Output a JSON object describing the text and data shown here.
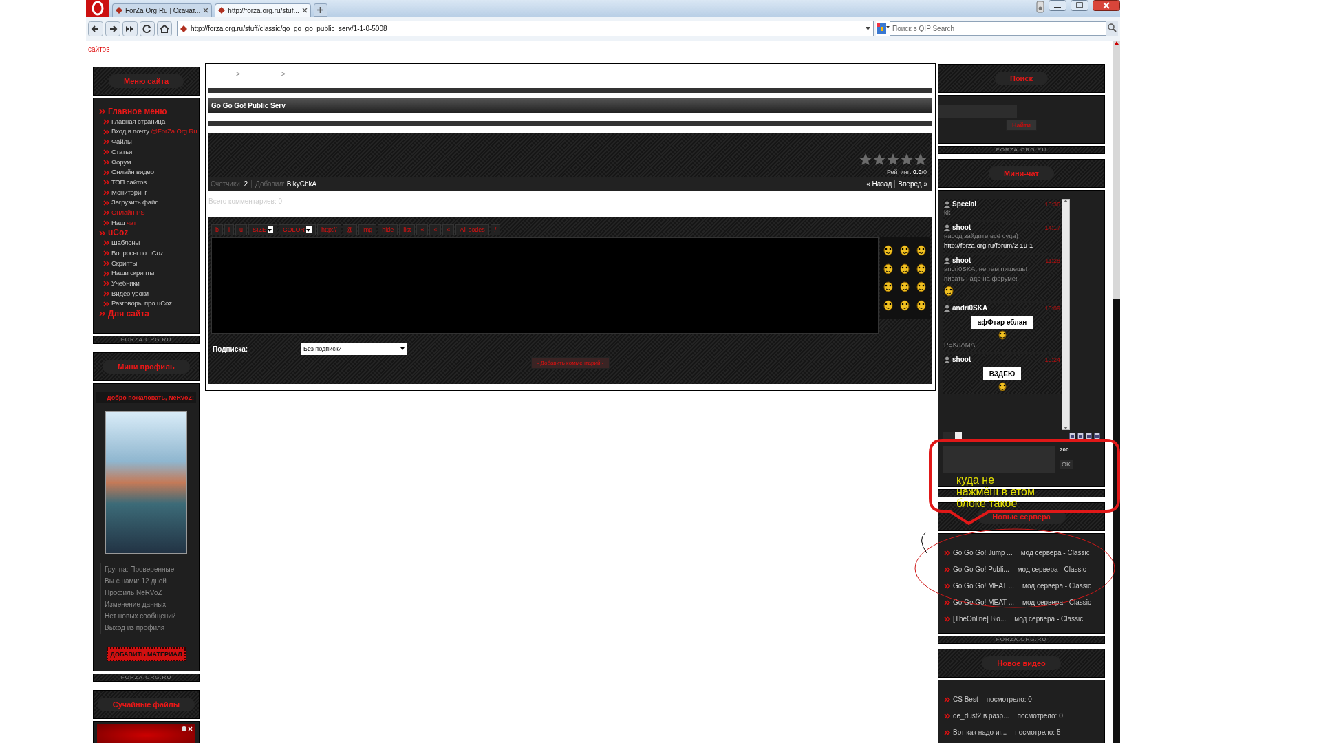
{
  "browser": {
    "tabs": [
      {
        "title": "ForZa Org Ru | Скачат...",
        "selected": false
      },
      {
        "title": "http://forza.org.ru/stuf...",
        "selected": true
      }
    ],
    "address": "http://forza.org.ru/stuff/classic/go_go_go_public_serv/1-1-0-5008",
    "search_placeholder": "Поиск в QIP Search",
    "status_text": "сайтов"
  },
  "left_column": [
    {
      "kind": "menu",
      "title": "Меню сайта",
      "footer": "FORZA.ORG.RU",
      "sections": [
        {
          "label": "Главное меню",
          "items": [
            {
              "parts": [
                {
                  "text": "Главная страница",
                  "accent": false
                }
              ]
            },
            {
              "parts": [
                {
                  "text": "Вход в почту ",
                  "accent": false
                },
                {
                  "text": "@ForZa.Org.Ru",
                  "accent": true
                }
              ]
            },
            {
              "parts": [
                {
                  "text": "Файлы",
                  "accent": false
                }
              ]
            },
            {
              "parts": [
                {
                  "text": "Статьи",
                  "accent": false
                }
              ]
            },
            {
              "parts": [
                {
                  "text": "Форум",
                  "accent": false
                }
              ]
            },
            {
              "parts": [
                {
                  "text": "Онлайн видео",
                  "accent": false
                }
              ]
            },
            {
              "parts": [
                {
                  "text": "ТОП сайтов",
                  "accent": false
                }
              ]
            },
            {
              "parts": [
                {
                  "text": "Мониторинг",
                  "accent": false
                }
              ]
            },
            {
              "parts": [
                {
                  "text": "Загрузить файл",
                  "accent": false
                }
              ]
            },
            {
              "parts": [
                {
                  "text": "Онлайн PS",
                  "accent": true
                }
              ]
            },
            {
              "parts": [
                {
                  "text": "Наш ",
                  "accent": false
                },
                {
                  "text": "чат",
                  "accent": true
                }
              ]
            }
          ]
        },
        {
          "label": "uCoz",
          "items": [
            {
              "parts": [
                {
                  "text": "Шаблоны",
                  "accent": false
                }
              ]
            },
            {
              "parts": [
                {
                  "text": "Вопросы по uCoz",
                  "accent": false
                }
              ]
            },
            {
              "parts": [
                {
                  "text": "Скрипты",
                  "accent": false
                }
              ]
            },
            {
              "parts": [
                {
                  "text": "Наши скрипты",
                  "accent": false
                }
              ]
            },
            {
              "parts": [
                {
                  "text": "Учебники",
                  "accent": false
                }
              ]
            },
            {
              "parts": [
                {
                  "text": "Видео уроки",
                  "accent": false
                }
              ]
            },
            {
              "parts": [
                {
                  "text": "Разговоры про uCoz",
                  "accent": false
                }
              ]
            }
          ]
        },
        {
          "label": "Для сайта"
        }
      ]
    },
    {
      "kind": "profile",
      "title": "Мини профиль",
      "footer": "FORZA.ORG.RU",
      "greeting": "Добро пожаловать, NeRvoZ!",
      "lines": [
        "Группа: Проверенные",
        "Вы с нами: 12 дней",
        "Профиль NeRVoZ",
        "Изменение данных",
        "Нет новых сообщений",
        "Выход из профиля"
      ],
      "button": "ДОБАВИТЬ МАТЕРИАЛ"
    },
    {
      "kind": "files",
      "title": "Сучайные файлы"
    }
  ],
  "content": {
    "breadcrumb_separators": [
      ">",
      ">"
    ],
    "title": "Go Go Go! Public Serv",
    "rating": {
      "stars": 0,
      "text": "Рейтинг: **0.0**/0"
    },
    "meta": [
      {
        "label": "Счетчики:",
        "value": "2"
      },
      {
        "label": "Добавил:",
        "value": "BikyCbkA"
      }
    ],
    "nav": [
      "« Назад",
      "Вперед »"
    ],
    "comments_total": "Всего комментариев: 0",
    "editor_tools": [
      {
        "kind": "button",
        "label": "b"
      },
      {
        "kind": "button",
        "label": "i"
      },
      {
        "kind": "button",
        "label": "u"
      },
      {
        "kind": "select",
        "label": "SIZE"
      },
      {
        "kind": "select",
        "label": "COLOR"
      },
      {
        "kind": "button",
        "label": "http://"
      },
      {
        "kind": "button",
        "label": "@"
      },
      {
        "kind": "button",
        "label": "img"
      },
      {
        "kind": "button",
        "label": "hide"
      },
      {
        "kind": "button",
        "label": "list"
      },
      {
        "kind": "button",
        "label": "«"
      },
      {
        "kind": "button",
        "label": "«"
      },
      {
        "kind": "button",
        "label": "«"
      },
      {
        "kind": "button",
        "label": "All codes"
      },
      {
        "kind": "button",
        "label": "/"
      }
    ],
    "subscription": {
      "label": "Подписка:",
      "value": "Без подписки"
    },
    "submit": "- Добавить комментарий -"
  },
  "right_column": [
    {
      "kind": "search",
      "title": "Поиск",
      "button": "Найти",
      "footer": "FORZA.ORG.RU"
    },
    {
      "kind": "chat",
      "title": "Мини-чат",
      "counter": "200",
      "send": "OK",
      "messages": [
        {
          "user": "Special",
          "time": "13:36",
          "content": [
            {
              "kind": "text",
              "text": "kk"
            }
          ]
        },
        {
          "user": "shoot",
          "time": "14:17",
          "content": [
            {
              "kind": "text",
              "text": "народ зайдите всё суда)"
            },
            {
              "kind": "link",
              "text": "http://forza.org.ru/forum/2-19-1"
            }
          ]
        },
        {
          "user": "shoot",
          "time": "11:28",
          "content": [
            {
              "kind": "text",
              "text": "andri0SKA, не там пишешь!"
            },
            {
              "kind": "text",
              "text": "писать надо на форуме!"
            },
            {
              "kind": "smiley"
            }
          ]
        },
        {
          "user": "andri0SKA",
          "time": "10:09",
          "content": [
            {
              "kind": "sign",
              "text": "афФтар еблан"
            },
            {
              "kind": "text",
              "text": "РЕКЛАМА"
            }
          ]
        },
        {
          "user": "shoot",
          "time": "19:24",
          "content": [
            {
              "kind": "sign",
              "text": "ВЗДЕЮ"
            }
          ]
        }
      ]
    },
    {
      "kind": "list",
      "title": "Новые сервера",
      "footer": "FORZA.ORG.RU",
      "items": [
        {
          "name": "Go Go Go! Jump ...",
          "info": "мод сервера - Classic"
        },
        {
          "name": "Go Go Go! Publi...",
          "info": "мод сервера - Classic"
        },
        {
          "name": "Go Go Go! MEAT ...",
          "info": "мод сервера - Classic"
        },
        {
          "name": "Go Go Go! MEAT ...",
          "info": "мод сервера - Classic"
        },
        {
          "name": "[TheOnline] Bio...",
          "info": "мод сервера - Classic"
        }
      ]
    },
    {
      "kind": "list",
      "title": "Новое видео",
      "items": [
        {
          "name": "CS Best",
          "info": "посмотрело: 0"
        },
        {
          "name": "de_dust2 в разр...",
          "info": "посмотрело: 0"
        },
        {
          "name": "Вот как надо иг...",
          "info": "посмотрело: 5"
        }
      ]
    }
  ],
  "annotation": {
    "lines": [
      "куда не",
      "нажмёш в етом",
      "блоке такое"
    ]
  }
}
